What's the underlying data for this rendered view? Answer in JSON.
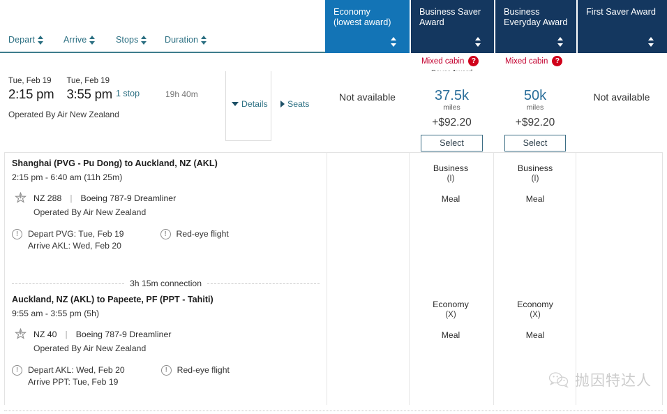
{
  "sort_bar": {
    "items": [
      {
        "label": "Depart",
        "icon": "sort-arrows-icon"
      },
      {
        "label": "Arrive",
        "icon": "sort-arrows-icon"
      },
      {
        "label": "Stops",
        "icon": "sort-arrows-icon"
      },
      {
        "label": "Duration",
        "icon": "sort-arrows-icon"
      }
    ]
  },
  "fare_columns": [
    {
      "line1": "Economy",
      "line2": "(lowest award)",
      "active": true,
      "sort_icon": "sort-arrows-icon"
    },
    {
      "line1": "Business Saver",
      "line2": "Award",
      "active": false,
      "sort_icon": "sort-arrows-icon"
    },
    {
      "line1": "Business",
      "line2": "Everyday Award",
      "active": false,
      "sort_icon": "sort-arrows-icon"
    },
    {
      "line1": "First Saver Award",
      "line2": "",
      "active": false,
      "sort_icon": "sort-arrows-icon"
    }
  ],
  "mixed_cabin": {
    "label_1": "Mixed cabin",
    "label_2": "Mixed cabin",
    "help_glyph": "?",
    "help_icon": "question-mark-help-icon",
    "saver_award_note": "Saver Award",
    "color": "#c3002f"
  },
  "summary": {
    "depart": {
      "date": "Tue, Feb 19",
      "time": "2:15 pm"
    },
    "arrive": {
      "date": "Tue, Feb 19",
      "time": "3:55 pm"
    },
    "stops": "1 stop",
    "duration": "19h 40m",
    "operated_by": "Operated By Air New Zealand",
    "details_label": "Details",
    "details_icon": "triangle-down-icon",
    "seats_label": "Seats",
    "seats_icon": "triangle-right-icon"
  },
  "fares": [
    {
      "type": "unavailable",
      "text": "Not available"
    },
    {
      "type": "price",
      "miles": "37.5k",
      "miles_unit": "miles",
      "taxes": "+$92.20",
      "select_label": "Select"
    },
    {
      "type": "price",
      "miles": "50k",
      "miles_unit": "miles",
      "taxes": "+$92.20",
      "select_label": "Select"
    },
    {
      "type": "unavailable",
      "text": "Not available"
    }
  ],
  "segments": [
    {
      "route": "Shanghai (PVG - Pu Dong) to Auckland, NZ (AKL)",
      "times": "2:15 pm - 6:40 am (11h 25m)",
      "logo_icon": "star-alliance-airline-logo-icon",
      "flight_no": "NZ 288",
      "separator": "|",
      "aircraft": "Boeing 787-9 Dreamliner",
      "operated_by": "Operated By Air New Zealand",
      "note_1_line_1": "Depart PVG: Tue, Feb 19",
      "note_1_line_2": "Arrive AKL: Wed, Feb 20",
      "note_2_line_1": "Red-eye flight",
      "note_icon": "exclamation-circle-icon",
      "cabins": [
        {
          "name": "Business",
          "code": "(I)",
          "meal": "Meal"
        },
        {
          "name": "Business",
          "code": "(I)",
          "meal": "Meal"
        }
      ]
    },
    {
      "route": "Auckland, NZ (AKL) to Papeete, PF (PPT - Tahiti)",
      "times": "9:55 am - 3:55 pm (5h)",
      "logo_icon": "star-alliance-airline-logo-icon",
      "flight_no": "NZ 40",
      "separator": "|",
      "aircraft": "Boeing 787-9 Dreamliner",
      "operated_by": "Operated By Air New Zealand",
      "note_1_line_1": "Depart AKL: Wed, Feb 20",
      "note_1_line_2": "Arrive PPT: Tue, Feb 19",
      "note_2_line_1": "Red-eye flight",
      "note_icon": "exclamation-circle-icon",
      "cabins": [
        {
          "name": "Economy",
          "code": "(X)",
          "meal": "Meal"
        },
        {
          "name": "Economy",
          "code": "(X)",
          "meal": "Meal"
        }
      ]
    }
  ],
  "connection": {
    "text": "3h 15m connection"
  },
  "watermark": {
    "text": "抛因特达人",
    "icon": "wechat-logo-icon"
  },
  "theme": {
    "tab_active": "#1374b6",
    "tab_inactive": "#14375f",
    "link": "#2b6f82",
    "alert_red": "#c3002f",
    "miles_blue": "#2b6f9b"
  }
}
